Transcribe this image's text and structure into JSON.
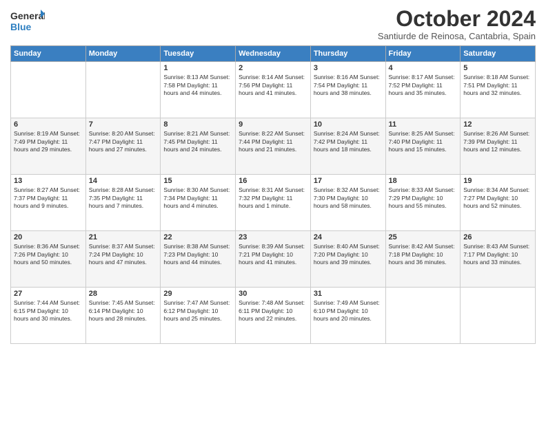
{
  "logo": {
    "line1": "General",
    "line2": "Blue"
  },
  "title": "October 2024",
  "subtitle": "Santiurde de Reinosa, Cantabria, Spain",
  "days_of_week": [
    "Sunday",
    "Monday",
    "Tuesday",
    "Wednesday",
    "Thursday",
    "Friday",
    "Saturday"
  ],
  "weeks": [
    [
      {
        "day": "",
        "info": ""
      },
      {
        "day": "",
        "info": ""
      },
      {
        "day": "1",
        "info": "Sunrise: 8:13 AM\nSunset: 7:58 PM\nDaylight: 11 hours and 44 minutes."
      },
      {
        "day": "2",
        "info": "Sunrise: 8:14 AM\nSunset: 7:56 PM\nDaylight: 11 hours and 41 minutes."
      },
      {
        "day": "3",
        "info": "Sunrise: 8:16 AM\nSunset: 7:54 PM\nDaylight: 11 hours and 38 minutes."
      },
      {
        "day": "4",
        "info": "Sunrise: 8:17 AM\nSunset: 7:52 PM\nDaylight: 11 hours and 35 minutes."
      },
      {
        "day": "5",
        "info": "Sunrise: 8:18 AM\nSunset: 7:51 PM\nDaylight: 11 hours and 32 minutes."
      }
    ],
    [
      {
        "day": "6",
        "info": "Sunrise: 8:19 AM\nSunset: 7:49 PM\nDaylight: 11 hours and 29 minutes."
      },
      {
        "day": "7",
        "info": "Sunrise: 8:20 AM\nSunset: 7:47 PM\nDaylight: 11 hours and 27 minutes."
      },
      {
        "day": "8",
        "info": "Sunrise: 8:21 AM\nSunset: 7:45 PM\nDaylight: 11 hours and 24 minutes."
      },
      {
        "day": "9",
        "info": "Sunrise: 8:22 AM\nSunset: 7:44 PM\nDaylight: 11 hours and 21 minutes."
      },
      {
        "day": "10",
        "info": "Sunrise: 8:24 AM\nSunset: 7:42 PM\nDaylight: 11 hours and 18 minutes."
      },
      {
        "day": "11",
        "info": "Sunrise: 8:25 AM\nSunset: 7:40 PM\nDaylight: 11 hours and 15 minutes."
      },
      {
        "day": "12",
        "info": "Sunrise: 8:26 AM\nSunset: 7:39 PM\nDaylight: 11 hours and 12 minutes."
      }
    ],
    [
      {
        "day": "13",
        "info": "Sunrise: 8:27 AM\nSunset: 7:37 PM\nDaylight: 11 hours and 9 minutes."
      },
      {
        "day": "14",
        "info": "Sunrise: 8:28 AM\nSunset: 7:35 PM\nDaylight: 11 hours and 7 minutes."
      },
      {
        "day": "15",
        "info": "Sunrise: 8:30 AM\nSunset: 7:34 PM\nDaylight: 11 hours and 4 minutes."
      },
      {
        "day": "16",
        "info": "Sunrise: 8:31 AM\nSunset: 7:32 PM\nDaylight: 11 hours and 1 minute."
      },
      {
        "day": "17",
        "info": "Sunrise: 8:32 AM\nSunset: 7:30 PM\nDaylight: 10 hours and 58 minutes."
      },
      {
        "day": "18",
        "info": "Sunrise: 8:33 AM\nSunset: 7:29 PM\nDaylight: 10 hours and 55 minutes."
      },
      {
        "day": "19",
        "info": "Sunrise: 8:34 AM\nSunset: 7:27 PM\nDaylight: 10 hours and 52 minutes."
      }
    ],
    [
      {
        "day": "20",
        "info": "Sunrise: 8:36 AM\nSunset: 7:26 PM\nDaylight: 10 hours and 50 minutes."
      },
      {
        "day": "21",
        "info": "Sunrise: 8:37 AM\nSunset: 7:24 PM\nDaylight: 10 hours and 47 minutes."
      },
      {
        "day": "22",
        "info": "Sunrise: 8:38 AM\nSunset: 7:23 PM\nDaylight: 10 hours and 44 minutes."
      },
      {
        "day": "23",
        "info": "Sunrise: 8:39 AM\nSunset: 7:21 PM\nDaylight: 10 hours and 41 minutes."
      },
      {
        "day": "24",
        "info": "Sunrise: 8:40 AM\nSunset: 7:20 PM\nDaylight: 10 hours and 39 minutes."
      },
      {
        "day": "25",
        "info": "Sunrise: 8:42 AM\nSunset: 7:18 PM\nDaylight: 10 hours and 36 minutes."
      },
      {
        "day": "26",
        "info": "Sunrise: 8:43 AM\nSunset: 7:17 PM\nDaylight: 10 hours and 33 minutes."
      }
    ],
    [
      {
        "day": "27",
        "info": "Sunrise: 7:44 AM\nSunset: 6:15 PM\nDaylight: 10 hours and 30 minutes."
      },
      {
        "day": "28",
        "info": "Sunrise: 7:45 AM\nSunset: 6:14 PM\nDaylight: 10 hours and 28 minutes."
      },
      {
        "day": "29",
        "info": "Sunrise: 7:47 AM\nSunset: 6:12 PM\nDaylight: 10 hours and 25 minutes."
      },
      {
        "day": "30",
        "info": "Sunrise: 7:48 AM\nSunset: 6:11 PM\nDaylight: 10 hours and 22 minutes."
      },
      {
        "day": "31",
        "info": "Sunrise: 7:49 AM\nSunset: 6:10 PM\nDaylight: 10 hours and 20 minutes."
      },
      {
        "day": "",
        "info": ""
      },
      {
        "day": "",
        "info": ""
      }
    ]
  ]
}
